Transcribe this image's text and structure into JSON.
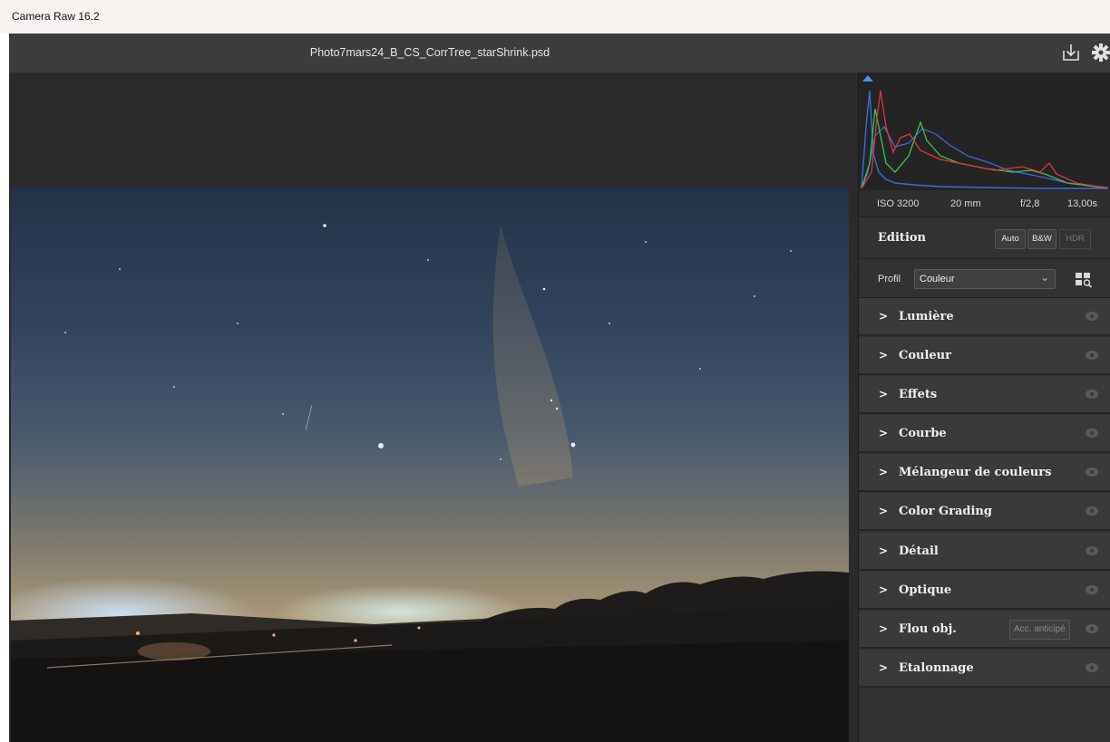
{
  "app": {
    "title": "Camera Raw 16.2"
  },
  "document": {
    "filename": "Photo7mars24_B_CS_CorrTree_starShrink.psd"
  },
  "header_icons": {
    "save": "save-download-icon",
    "settings": "gear-icon"
  },
  "exif": {
    "iso": "ISO 3200",
    "focal": "20 mm",
    "aperture": "f/2,8",
    "shutter": "13,00s"
  },
  "edit": {
    "title": "Edition",
    "buttons": {
      "auto": "Auto",
      "bw": "B&W",
      "hdr": "HDR"
    }
  },
  "profile": {
    "label": "Profil",
    "value": "Couleur",
    "browse_icon": "profile-browser-icon"
  },
  "sections": [
    {
      "label": "Lumière"
    },
    {
      "label": "Couleur"
    },
    {
      "label": "Effets"
    },
    {
      "label": "Courbe"
    },
    {
      "label": "Mélangeur de couleurs"
    },
    {
      "label": "Color Grading"
    },
    {
      "label": "Détail"
    },
    {
      "label": "Optique"
    },
    {
      "label": "Flou obj.",
      "badge": "Acc. anticipé"
    },
    {
      "label": "Etalonnage"
    }
  ],
  "colors": {
    "panel_bg": "#323232",
    "section_bg": "#3a3a3a",
    "canvas_bg": "#2b2b2b",
    "header_bg": "#3c3c3c",
    "histogram_red": "#e0353d",
    "histogram_green": "#3fbf4f",
    "histogram_blue": "#3a6fd8"
  }
}
